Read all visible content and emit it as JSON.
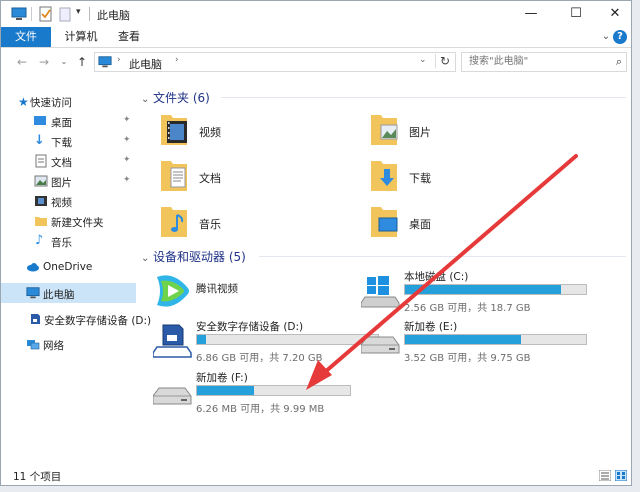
{
  "window": {
    "title": "此电脑",
    "controls": {
      "minimize": "—",
      "maximize": "☐",
      "close": "✕"
    }
  },
  "ribbon": {
    "tabs": [
      {
        "label": "文件"
      },
      {
        "label": "计算机"
      },
      {
        "label": "查看"
      }
    ]
  },
  "address": {
    "path": "此电脑",
    "search_placeholder": "搜索\"此电脑\""
  },
  "sidebar": {
    "items": [
      {
        "label": "快速访问",
        "icon": "star-icon",
        "pinned": false
      },
      {
        "label": "桌面",
        "icon": "desktop-icon",
        "pinned": true
      },
      {
        "label": "下载",
        "icon": "download-icon",
        "pinned": true
      },
      {
        "label": "文档",
        "icon": "document-icon",
        "pinned": true
      },
      {
        "label": "图片",
        "icon": "picture-icon",
        "pinned": true
      },
      {
        "label": "视频",
        "icon": "video-icon",
        "pinned": false
      },
      {
        "label": "新建文件夹",
        "icon": "folder-icon",
        "pinned": false
      },
      {
        "label": "音乐",
        "icon": "music-icon",
        "pinned": false
      },
      {
        "label": "OneDrive",
        "icon": "cloud-icon",
        "pinned": false
      },
      {
        "label": "此电脑",
        "icon": "computer-icon",
        "pinned": false,
        "selected": true
      },
      {
        "label": "安全数字存储设备 (D:)",
        "icon": "sd-card-icon",
        "pinned": false
      },
      {
        "label": "网络",
        "icon": "network-icon",
        "pinned": false
      }
    ]
  },
  "folders_group": {
    "title": "文件夹 (6)",
    "items": [
      {
        "label": "视频",
        "icon": "video-folder-icon"
      },
      {
        "label": "图片",
        "icon": "pictures-folder-icon"
      },
      {
        "label": "文档",
        "icon": "documents-folder-icon"
      },
      {
        "label": "下载",
        "icon": "downloads-folder-icon"
      },
      {
        "label": "音乐",
        "icon": "music-folder-icon"
      },
      {
        "label": "桌面",
        "icon": "desktop-folder-icon"
      }
    ]
  },
  "drives_group": {
    "title": "设备和驱动器 (5)",
    "items": [
      {
        "name": "腾讯视频",
        "icon": "tencent-video-icon",
        "has_bar": false
      },
      {
        "name": "本地磁盘 (C:)",
        "icon": "windows-drive-icon",
        "has_bar": true,
        "used_fraction": 0.86,
        "free_text": "2.56 GB 可用，共 18.7 GB"
      },
      {
        "name": "安全数字存储设备 (D:)",
        "icon": "sd-card-drive-icon",
        "has_bar": true,
        "used_fraction": 0.05,
        "free_text": "6.86 GB 可用，共 7.20 GB"
      },
      {
        "name": "新加卷 (E:)",
        "icon": "hard-drive-icon",
        "has_bar": true,
        "used_fraction": 0.64,
        "free_text": "3.52 GB 可用，共 9.75 GB"
      },
      {
        "name": "新加卷 (F:)",
        "icon": "hard-drive-icon",
        "has_bar": true,
        "used_fraction": 0.37,
        "free_text": "6.26 MB 可用，共 9.99 MB"
      }
    ]
  },
  "status": {
    "text": "11 个项目"
  },
  "colors": {
    "accent": "#1979ca",
    "bar_fill": "#26a0da",
    "selection": "#cce4f7",
    "annotation_arrow": "#e63a3a"
  }
}
